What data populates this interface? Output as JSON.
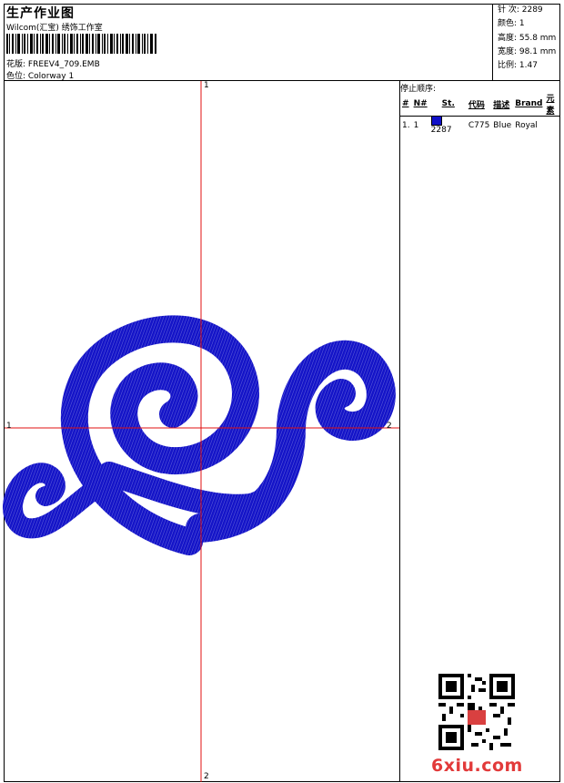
{
  "header": {
    "title": "生产作业图",
    "subtitle": "Wilcom(汇宝) 绣饰工作室",
    "design_label": "花版: FREEV4_709.EMB",
    "colorway_label": "色位: Colorway 1"
  },
  "stats": [
    {
      "label": "针 ",
      "value": "2289",
      "text": "针 次: 2289"
    },
    {
      "label": "颜色",
      "value": "1",
      "text": "颜色: 1"
    },
    {
      "label": "高度",
      "value": "55.8 mm",
      "text": "高度: 55.8 mm"
    },
    {
      "label": "宽度",
      "value": "98.1 mm",
      "text": "宽度: 98.1 mm"
    },
    {
      "label": "比例",
      "value": "1.47",
      "text": "比例: 1.47"
    }
  ],
  "stop_sequence": {
    "title": "停止顺序:",
    "headers": [
      "#",
      "N#",
      "St.",
      "代码",
      "描述",
      "Brand",
      "元素"
    ],
    "rows": [
      {
        "index": "1.",
        "needle": "1",
        "swatch_color": "#1010c8",
        "stitches": "2287",
        "code": "C775",
        "description": "Blue",
        "brand": "Royal",
        "element": ""
      }
    ]
  },
  "axis_labels": {
    "top": "1",
    "bottom": "2",
    "left": "1",
    "right": "2"
  },
  "colors": {
    "thread": "#1414c8",
    "crosshair": "#e01010",
    "watermark": "#e23a3a"
  },
  "watermark": "6xiu.com"
}
